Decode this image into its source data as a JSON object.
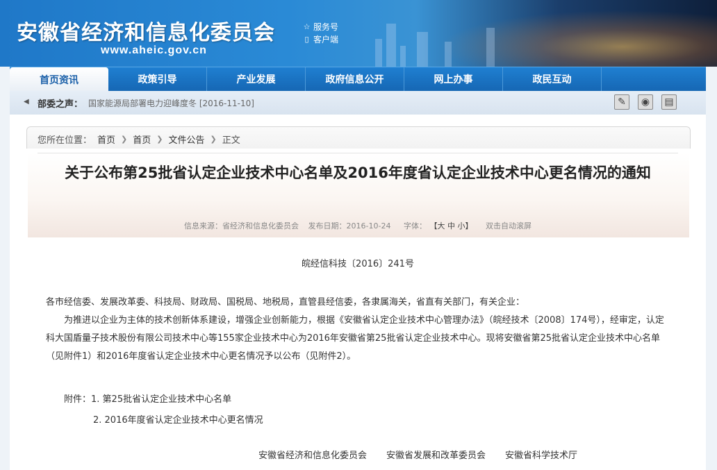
{
  "header": {
    "site_title": "安徽省经济和信息化委员会",
    "site_url": "www.aheic.gov.cn",
    "links": [
      {
        "icon": "star-icon",
        "label": "服务号"
      },
      {
        "icon": "mobile-icon",
        "label": "客户端"
      }
    ]
  },
  "nav": {
    "items": [
      {
        "label": "首页资讯",
        "active": true
      },
      {
        "label": "政策引导"
      },
      {
        "label": "产业发展"
      },
      {
        "label": "政府信息公开"
      },
      {
        "label": "网上办事"
      },
      {
        "label": "政民互动"
      }
    ]
  },
  "ticker": {
    "label": "部委之声：",
    "news": "国家能源局部署电力迎峰度冬 [2016-11-10]",
    "icons": [
      "notepad-icon",
      "camera-icon",
      "film-icon"
    ]
  },
  "breadcrumb": {
    "prefix": "您所在位置：",
    "items": [
      "首页",
      "首页",
      "文件公告",
      "正文"
    ]
  },
  "article": {
    "title": "关于公布第25批省认定企业技术中心名单及2016年度省认定企业技术中心更名情况的通知",
    "meta": {
      "source": "信息来源：省经济和信息化委员会",
      "date": "发布日期：2016-10-24",
      "fontsize_label": "字体：",
      "fontsize_options": "【大 中 小】",
      "autoscroll": "双击自动滚屏"
    },
    "doc_number": "皖经信科技〔2016〕241号",
    "addressee": "各市经信委、发展改革委、科技局、财政局、国税局、地税局，直管县经信委，各隶属海关，省直有关部门，有关企业：",
    "paragraph": "为推进以企业为主体的技术创新体系建设，增强企业创新能力，根据《安徽省认定企业技术中心管理办法》（皖经技术〔2008〕174号），经审定，认定科大国盾量子技术股份有限公司技术中心等155家企业技术中心为2016年安徽省第25批省认定企业技术中心。现将安徽省第25批省认定企业技术中心名单（见附件1）和2016年度省认定企业技术中心更名情况予以公布（见附件2）。",
    "attachments_label": "附件：",
    "attachment_1": "1. 第25批省认定企业技术中心名单",
    "attachment_2": "2. 2016年度省认定企业技术中心更名情况",
    "signatories": [
      "安徽省经济和信息化委员会",
      "安徽省发展和改革委员会",
      "安徽省科学技术厅"
    ]
  }
}
